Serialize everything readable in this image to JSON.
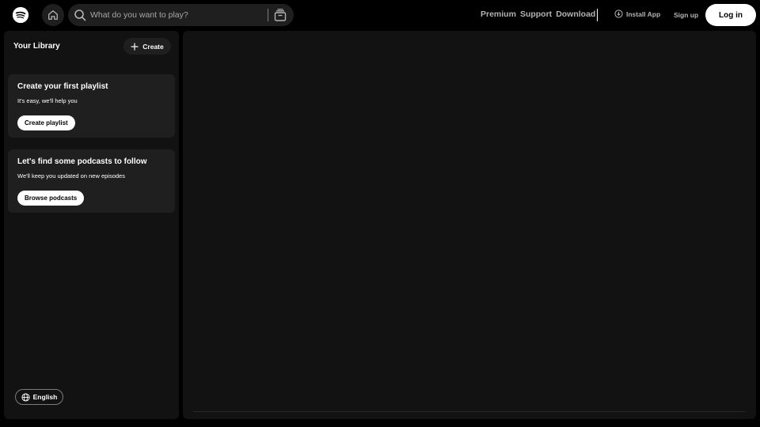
{
  "app": {
    "name": "Spotify",
    "brand_color": "#1ed760",
    "background_color": "#000000",
    "panel_color": "#121212",
    "logo_icon": "spotify-logo-icon"
  },
  "header": {
    "home_icon": "home-icon",
    "search": {
      "icon": "search-icon",
      "placeholder": "What do you want to play?",
      "value": "",
      "browse_icon": "browse-icon"
    },
    "nav": {
      "premium": "Premium",
      "support": "Support",
      "download": "Download"
    },
    "install_app": {
      "icon": "download-circle-icon",
      "label": "Install App"
    },
    "signup_label": "Sign up",
    "login_label": "Log in"
  },
  "sidebar": {
    "title": "Your Library",
    "create": {
      "icon": "plus-icon",
      "label": "Create"
    },
    "cards": [
      {
        "title": "Create your first playlist",
        "subtitle": "It's easy, we'll help you",
        "button": "Create playlist"
      },
      {
        "title": "Let's find some podcasts to follow",
        "subtitle": "We'll keep you updated on new episodes",
        "button": "Browse podcasts"
      }
    ],
    "language": {
      "icon": "globe-icon",
      "label": "English"
    }
  }
}
